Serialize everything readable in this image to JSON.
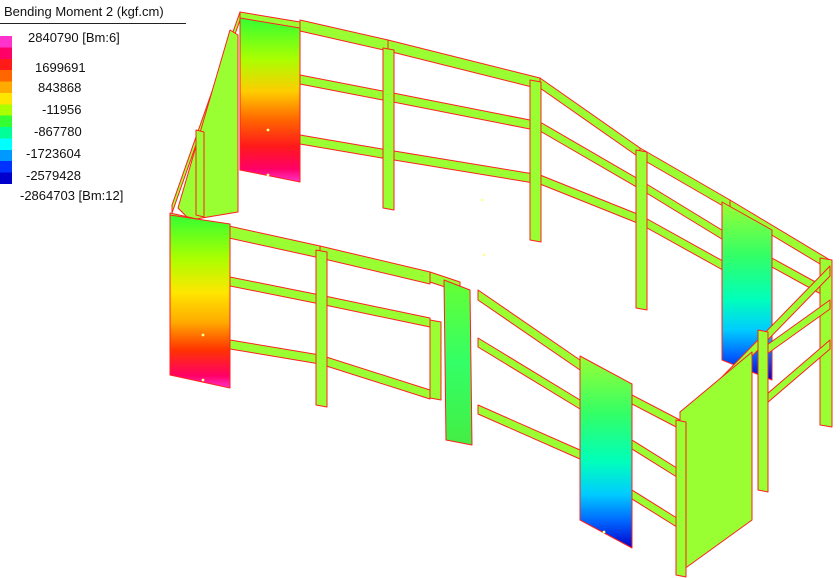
{
  "legend": {
    "title": "Bending Moment 2 (kgf.cm)",
    "max_label": "2840790 [Bm:6]",
    "min_label": "-2864703 [Bm:12]",
    "ticks": [
      "1699691",
      "843868",
      "-11956",
      "-867780",
      "-1723604",
      "-2579428"
    ],
    "colors": [
      "#ff33cc",
      "#ff0066",
      "#ff1a1a",
      "#ff6600",
      "#ffaa00",
      "#ffe600",
      "#aaff00",
      "#33ff33",
      "#00ff99",
      "#00ffff",
      "#0099ff",
      "#0033ff",
      "#0000cc"
    ]
  },
  "model": {
    "frame_color": "#99ff33",
    "edge_color": "#ff2020"
  }
}
